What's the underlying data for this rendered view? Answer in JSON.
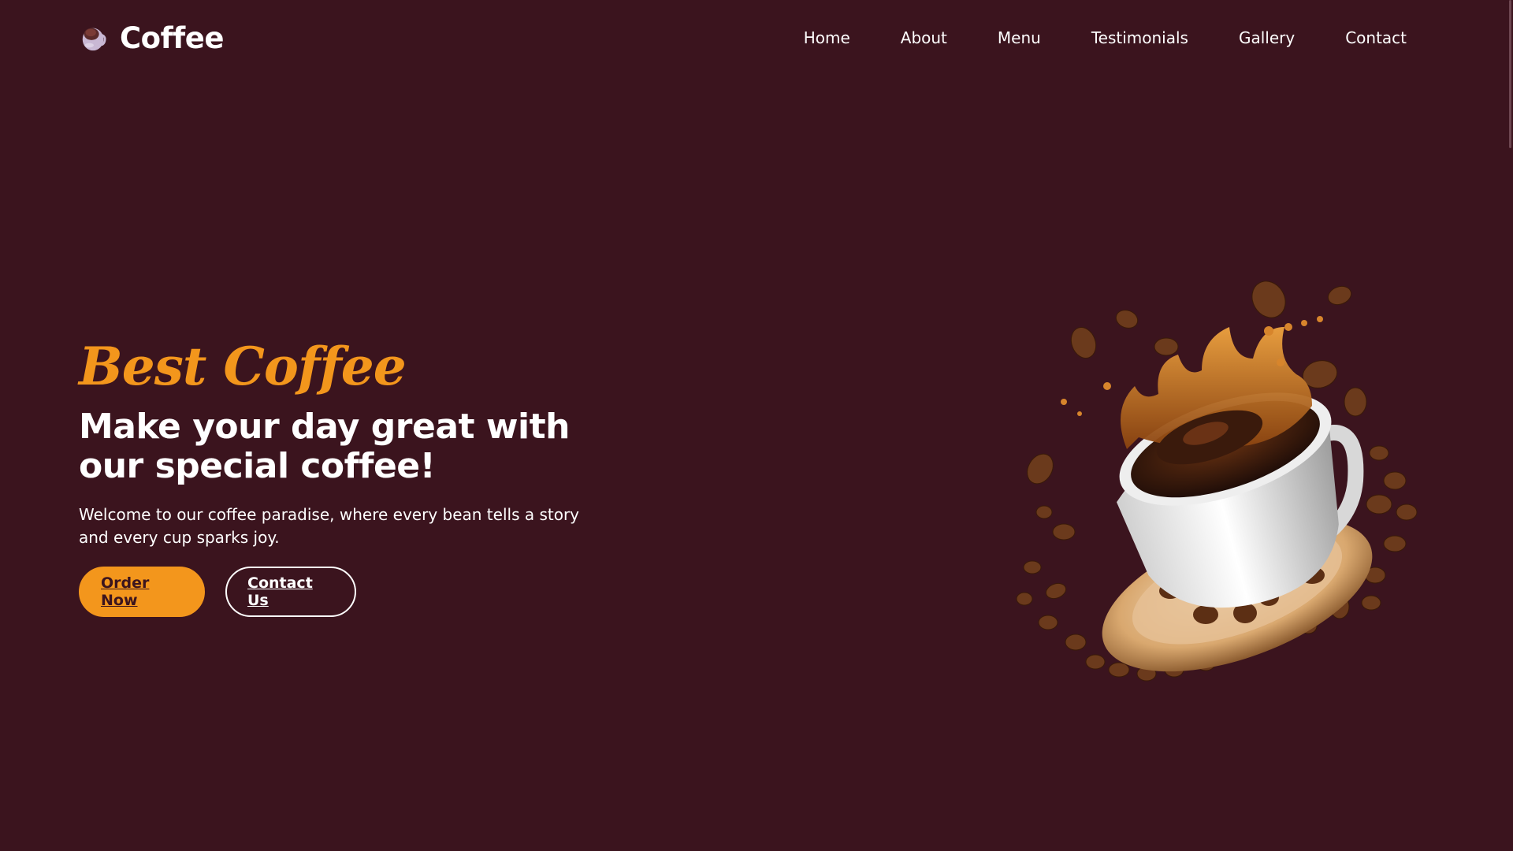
{
  "brand": {
    "name": "Coffee",
    "icon": "coffee-cup-icon"
  },
  "nav": {
    "items": [
      {
        "label": "Home"
      },
      {
        "label": "About"
      },
      {
        "label": "Menu"
      },
      {
        "label": "Testimonials"
      },
      {
        "label": "Gallery"
      },
      {
        "label": "Contact"
      }
    ]
  },
  "hero": {
    "subtitle": "Best Coffee",
    "title_line1": "Make your day great with",
    "title_line2": "our special coffee!",
    "description": "Welcome to our coffee paradise, where every bean tells a story and every cup sparks joy.",
    "order_button": "Order Now",
    "contact_button": "Contact Us",
    "image": "coffee-splash-cup-image"
  },
  "colors": {
    "background": "#3b141e",
    "accent": "#f3961c",
    "text": "#ffffff"
  }
}
